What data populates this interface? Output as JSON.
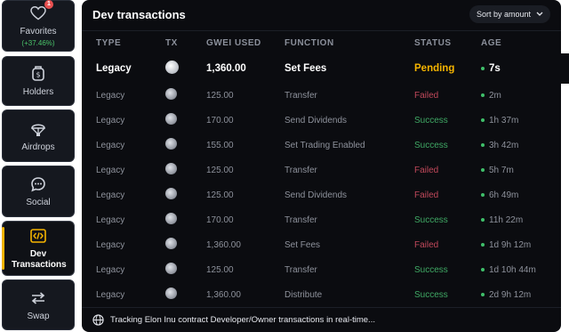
{
  "sidebar": {
    "items": [
      {
        "label": "Favorites",
        "sub": "(+37.46%)",
        "badge": "1",
        "icon": "heart-icon"
      },
      {
        "label": "Holders",
        "icon": "holders-icon"
      },
      {
        "label": "Airdrops",
        "icon": "parachute-icon"
      },
      {
        "label": "Social",
        "icon": "chat-icon"
      },
      {
        "label": "Dev Transactions",
        "icon": "code-icon"
      },
      {
        "label": "Swap",
        "icon": "swap-icon"
      }
    ],
    "active_index": 4
  },
  "panel": {
    "title": "Dev transactions",
    "sort_label": "Sort by amount",
    "footer_text": "Tracking Elon Inu contract Developer/Owner transactions in real-time..."
  },
  "table": {
    "columns": [
      "TYPE",
      "TX",
      "GWEI USED",
      "FUNCTION",
      "STATUS",
      "AGE"
    ],
    "rows": [
      {
        "type": "Legacy",
        "gwei": "1,360.00",
        "function": "Set Fees",
        "status": "Pending",
        "age": "7s"
      },
      {
        "type": "Legacy",
        "gwei": "125.00",
        "function": "Transfer",
        "status": "Failed",
        "age": "2m"
      },
      {
        "type": "Legacy",
        "gwei": "170.00",
        "function": "Send Dividends",
        "status": "Success",
        "age": "1h 37m"
      },
      {
        "type": "Legacy",
        "gwei": "155.00",
        "function": "Set Trading Enabled",
        "status": "Success",
        "age": "3h 42m"
      },
      {
        "type": "Legacy",
        "gwei": "125.00",
        "function": "Transfer",
        "status": "Failed",
        "age": "5h 7m"
      },
      {
        "type": "Legacy",
        "gwei": "125.00",
        "function": "Send Dividends",
        "status": "Failed",
        "age": "6h 49m"
      },
      {
        "type": "Legacy",
        "gwei": "170.00",
        "function": "Transfer",
        "status": "Success",
        "age": "11h 22m"
      },
      {
        "type": "Legacy",
        "gwei": "1,360.00",
        "function": "Set Fees",
        "status": "Failed",
        "age": "1d 9h 12m"
      },
      {
        "type": "Legacy",
        "gwei": "125.00",
        "function": "Transfer",
        "status": "Success",
        "age": "1d 10h 44m"
      },
      {
        "type": "Legacy",
        "gwei": "1,360.00",
        "function": "Distribute",
        "status": "Success",
        "age": "2d 9h 12m"
      }
    ]
  },
  "colors": {
    "accent": "#f5b400",
    "pending": "#f5b400",
    "failed": "#c0485a",
    "success": "#3fa864",
    "panel_bg": "#0b0c10"
  }
}
